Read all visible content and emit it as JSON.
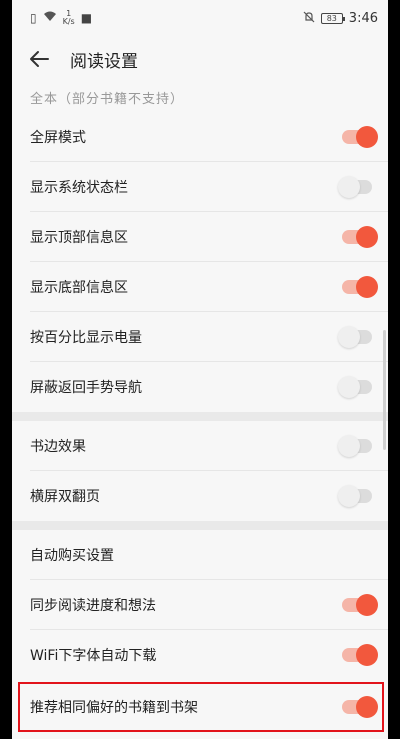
{
  "status_bar": {
    "speed_value": "1",
    "speed_unit": "K/s",
    "battery": "83",
    "time": "3:46"
  },
  "header": {
    "title": "阅读设置"
  },
  "truncated_item": "全本（部分书籍不支持）",
  "sections": [
    {
      "rows": [
        {
          "label": "全屏模式",
          "on": true
        },
        {
          "label": "显示系统状态栏",
          "on": false
        },
        {
          "label": "显示顶部信息区",
          "on": true
        },
        {
          "label": "显示底部信息区",
          "on": true
        },
        {
          "label": "按百分比显示电量",
          "on": false
        },
        {
          "label": "屏蔽返回手势导航",
          "on": false
        }
      ]
    },
    {
      "rows": [
        {
          "label": "书边效果",
          "on": false
        },
        {
          "label": "横屏双翻页",
          "on": false
        }
      ]
    },
    {
      "rows": [
        {
          "label": "自动购买设置",
          "on": null
        },
        {
          "label": "同步阅读进度和想法",
          "on": true
        },
        {
          "label": "WiFi下字体自动下载",
          "on": true
        }
      ]
    }
  ],
  "highlighted_row": {
    "label": "推荐相同偏好的书籍到书架",
    "on": true
  },
  "colors": {
    "accent": "#f2583d",
    "highlight_border": "#e2141b"
  }
}
